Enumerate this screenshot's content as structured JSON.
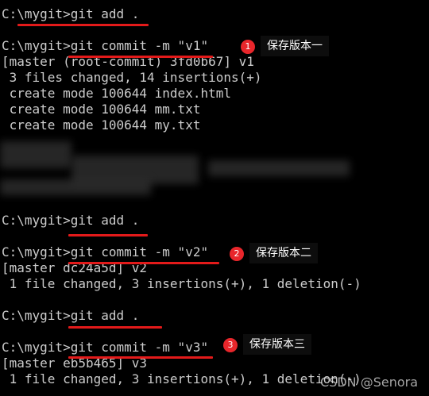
{
  "terminal": {
    "lines": [
      "C:\\mygit>git add .",
      "",
      "C:\\mygit>git commit -m \"v1\"",
      "[master (root-commit) 3fd0b67] v1",
      " 3 files changed, 14 insertions(+)",
      " create mode 100644 index.html",
      " create mode 100644 mm.txt",
      " create mode 100644 my.txt",
      "C:\\mygit>git add .",
      "C:\\mygit>git commit -m \"v2\"",
      "[master dc24a5d] v2",
      " 1 file changed, 3 insertions(+), 1 deletion(-)",
      "C:\\mygit>git add .",
      "C:\\mygit>git commit -m \"v3\"",
      "[master eb5b465] v3",
      " 1 file changed, 3 insertions(+), 1 deletion(-)"
    ]
  },
  "annotations": [
    {
      "number": "1",
      "label": "保存版本一"
    },
    {
      "number": "2",
      "label": "保存版本二"
    },
    {
      "number": "3",
      "label": "保存版本三"
    }
  ],
  "watermark": "CSDN @Senora",
  "colors": {
    "background": "#000000",
    "text": "#cccccc",
    "underline": "#e31a1a",
    "badge": "#e8262b"
  }
}
